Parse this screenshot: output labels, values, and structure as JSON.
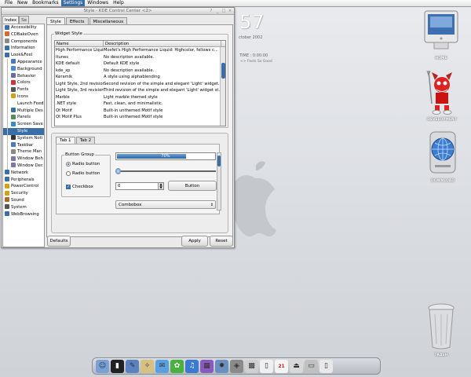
{
  "menubar": {
    "items": [
      "File",
      "New",
      "Bookmarks",
      "Settings",
      "Windows",
      "Help"
    ],
    "active_index": 3
  },
  "clock": {
    "big": "57",
    "date": "ctober 2002",
    "time": "TIME : 0:00:00",
    "sub": "<> Feels So Good"
  },
  "desktop_icons": {
    "home": "HOME",
    "development": "DEVELOPMENT",
    "download": "DOWNLOAD",
    "trash": "TRASH"
  },
  "window": {
    "title": "Style - KDE Control Center <2>",
    "title_buttons": [
      "?",
      "_",
      "□",
      "×"
    ],
    "side_tabs": [
      "Index",
      "Se"
    ],
    "tree": [
      {
        "label": "Accessibility",
        "level": 0,
        "color": "#3a6ea5"
      },
      {
        "label": "CDBakeOven",
        "level": 0,
        "color": "#d46a2a"
      },
      {
        "label": "Components",
        "level": 0,
        "color": "#8a8a8a"
      },
      {
        "label": "Information",
        "level": 0,
        "color": "#3a6ea5"
      },
      {
        "label": "Look&Feel",
        "level": 0,
        "color": "#3a6ea5"
      },
      {
        "label": "Appearance",
        "level": 1,
        "color": "#4a7abf"
      },
      {
        "label": "Background",
        "level": 1,
        "color": "#4a8acf"
      },
      {
        "label": "Behavior",
        "level": 1,
        "color": "#6a6aaa"
      },
      {
        "label": "Colors",
        "level": 1,
        "color": "#c23a3a"
      },
      {
        "label": "Fonts",
        "level": 1,
        "color": "#555555"
      },
      {
        "label": "Icons",
        "level": 1,
        "color": "#d4a01a"
      },
      {
        "label": "Launch Feed",
        "level": 1,
        "color": "#ffffff"
      },
      {
        "label": "Multiple Des",
        "level": 1,
        "color": "#3a6ea5"
      },
      {
        "label": "Panels",
        "level": 1,
        "color": "#5a8a5a"
      },
      {
        "label": "Screen Save",
        "level": 1,
        "color": "#3a8aca"
      },
      {
        "label": "Style",
        "level": 1,
        "color": "#3a6ea5",
        "selected": true
      },
      {
        "label": "System Noti",
        "level": 1,
        "color": "#333333"
      },
      {
        "label": "Taskbar",
        "level": 1,
        "color": "#4a7abf"
      },
      {
        "label": "Theme Man",
        "level": 1,
        "color": "#888888"
      },
      {
        "label": "Window Beh",
        "level": 1,
        "color": "#7a7aaa"
      },
      {
        "label": "Window Dec",
        "level": 1,
        "color": "#7a7aaa"
      },
      {
        "label": "Network",
        "level": 0,
        "color": "#3a6ea5"
      },
      {
        "label": "Peripherals",
        "level": 0,
        "color": "#3a6ea5"
      },
      {
        "label": "PowerControl",
        "level": 0,
        "color": "#d4a01a"
      },
      {
        "label": "Security",
        "level": 0,
        "color": "#d4a01a"
      },
      {
        "label": "Sound",
        "level": 0,
        "color": "#aa6a2a"
      },
      {
        "label": "System",
        "level": 0,
        "color": "#555555"
      },
      {
        "label": "WebBrowsing",
        "level": 0,
        "color": "#3a6ea5"
      }
    ],
    "main_tabs": [
      "Style",
      "Effects",
      "Miscellaneous"
    ],
    "widget_style_group": "Widget Style",
    "list_headers": [
      "Name",
      "Description"
    ],
    "styles": [
      {
        "name": "High Performance Liquid",
        "desc": "Mosfet's High Performance Liquid: Highcolor, follows c..."
      },
      {
        "name": "ltunes",
        "desc": "No description available."
      },
      {
        "name": "KDE default",
        "desc": "Default KDE style"
      },
      {
        "name": "kde_xp",
        "desc": "No description available."
      },
      {
        "name": "Keramik",
        "desc": "A style using alphablending"
      },
      {
        "name": "Light Style, 2nd revision",
        "desc": "Second revision of the simple and elegant 'Light' widget..."
      },
      {
        "name": "Light Style, 3rd revision",
        "desc": "Third revision of the simple and elegant 'Light' widget st..."
      },
      {
        "name": "Marble",
        "desc": "Light marble themed style"
      },
      {
        "name": ".NET style",
        "desc": "Fast, clean, and minimalistic."
      },
      {
        "name": "Qt Motif",
        "desc": "Built-in unthemed Motif style"
      },
      {
        "name": "Qt Motif Plus",
        "desc": "Built-in unthemed Motif style"
      }
    ],
    "preview": {
      "tabs": [
        "Tab 1",
        "Tab 2"
      ],
      "group_title": "Button Group",
      "radio1": "Radio button",
      "radio2": "Radio button",
      "checkbox": "Checkbox",
      "progress_text": "70%",
      "progress": 0.7,
      "spin_value": "0",
      "button": "Button",
      "combo": "Combobox"
    },
    "buttons": {
      "defaults": "Defaults",
      "apply": "Apply",
      "reset": "Reset"
    }
  },
  "dock_icons": [
    "finder-icon",
    "terminal-icon",
    "app-icon",
    "safari-icon",
    "mail-icon",
    "ichat-icon",
    "itunes-icon",
    "imovie-icon",
    "iphoto-icon",
    "gimp-icon",
    "preview-icon",
    "ipod-icon",
    "ical-icon",
    "eject-icon",
    "drive-icon",
    "trash-dock-icon"
  ],
  "dock_glyphs": [
    "☺",
    "▮",
    "✎",
    "✧",
    "✉",
    "✿",
    "♫",
    "▦",
    "✹",
    "◈",
    "▩",
    "▯",
    "21",
    "⏏",
    "▭",
    "▯"
  ]
}
